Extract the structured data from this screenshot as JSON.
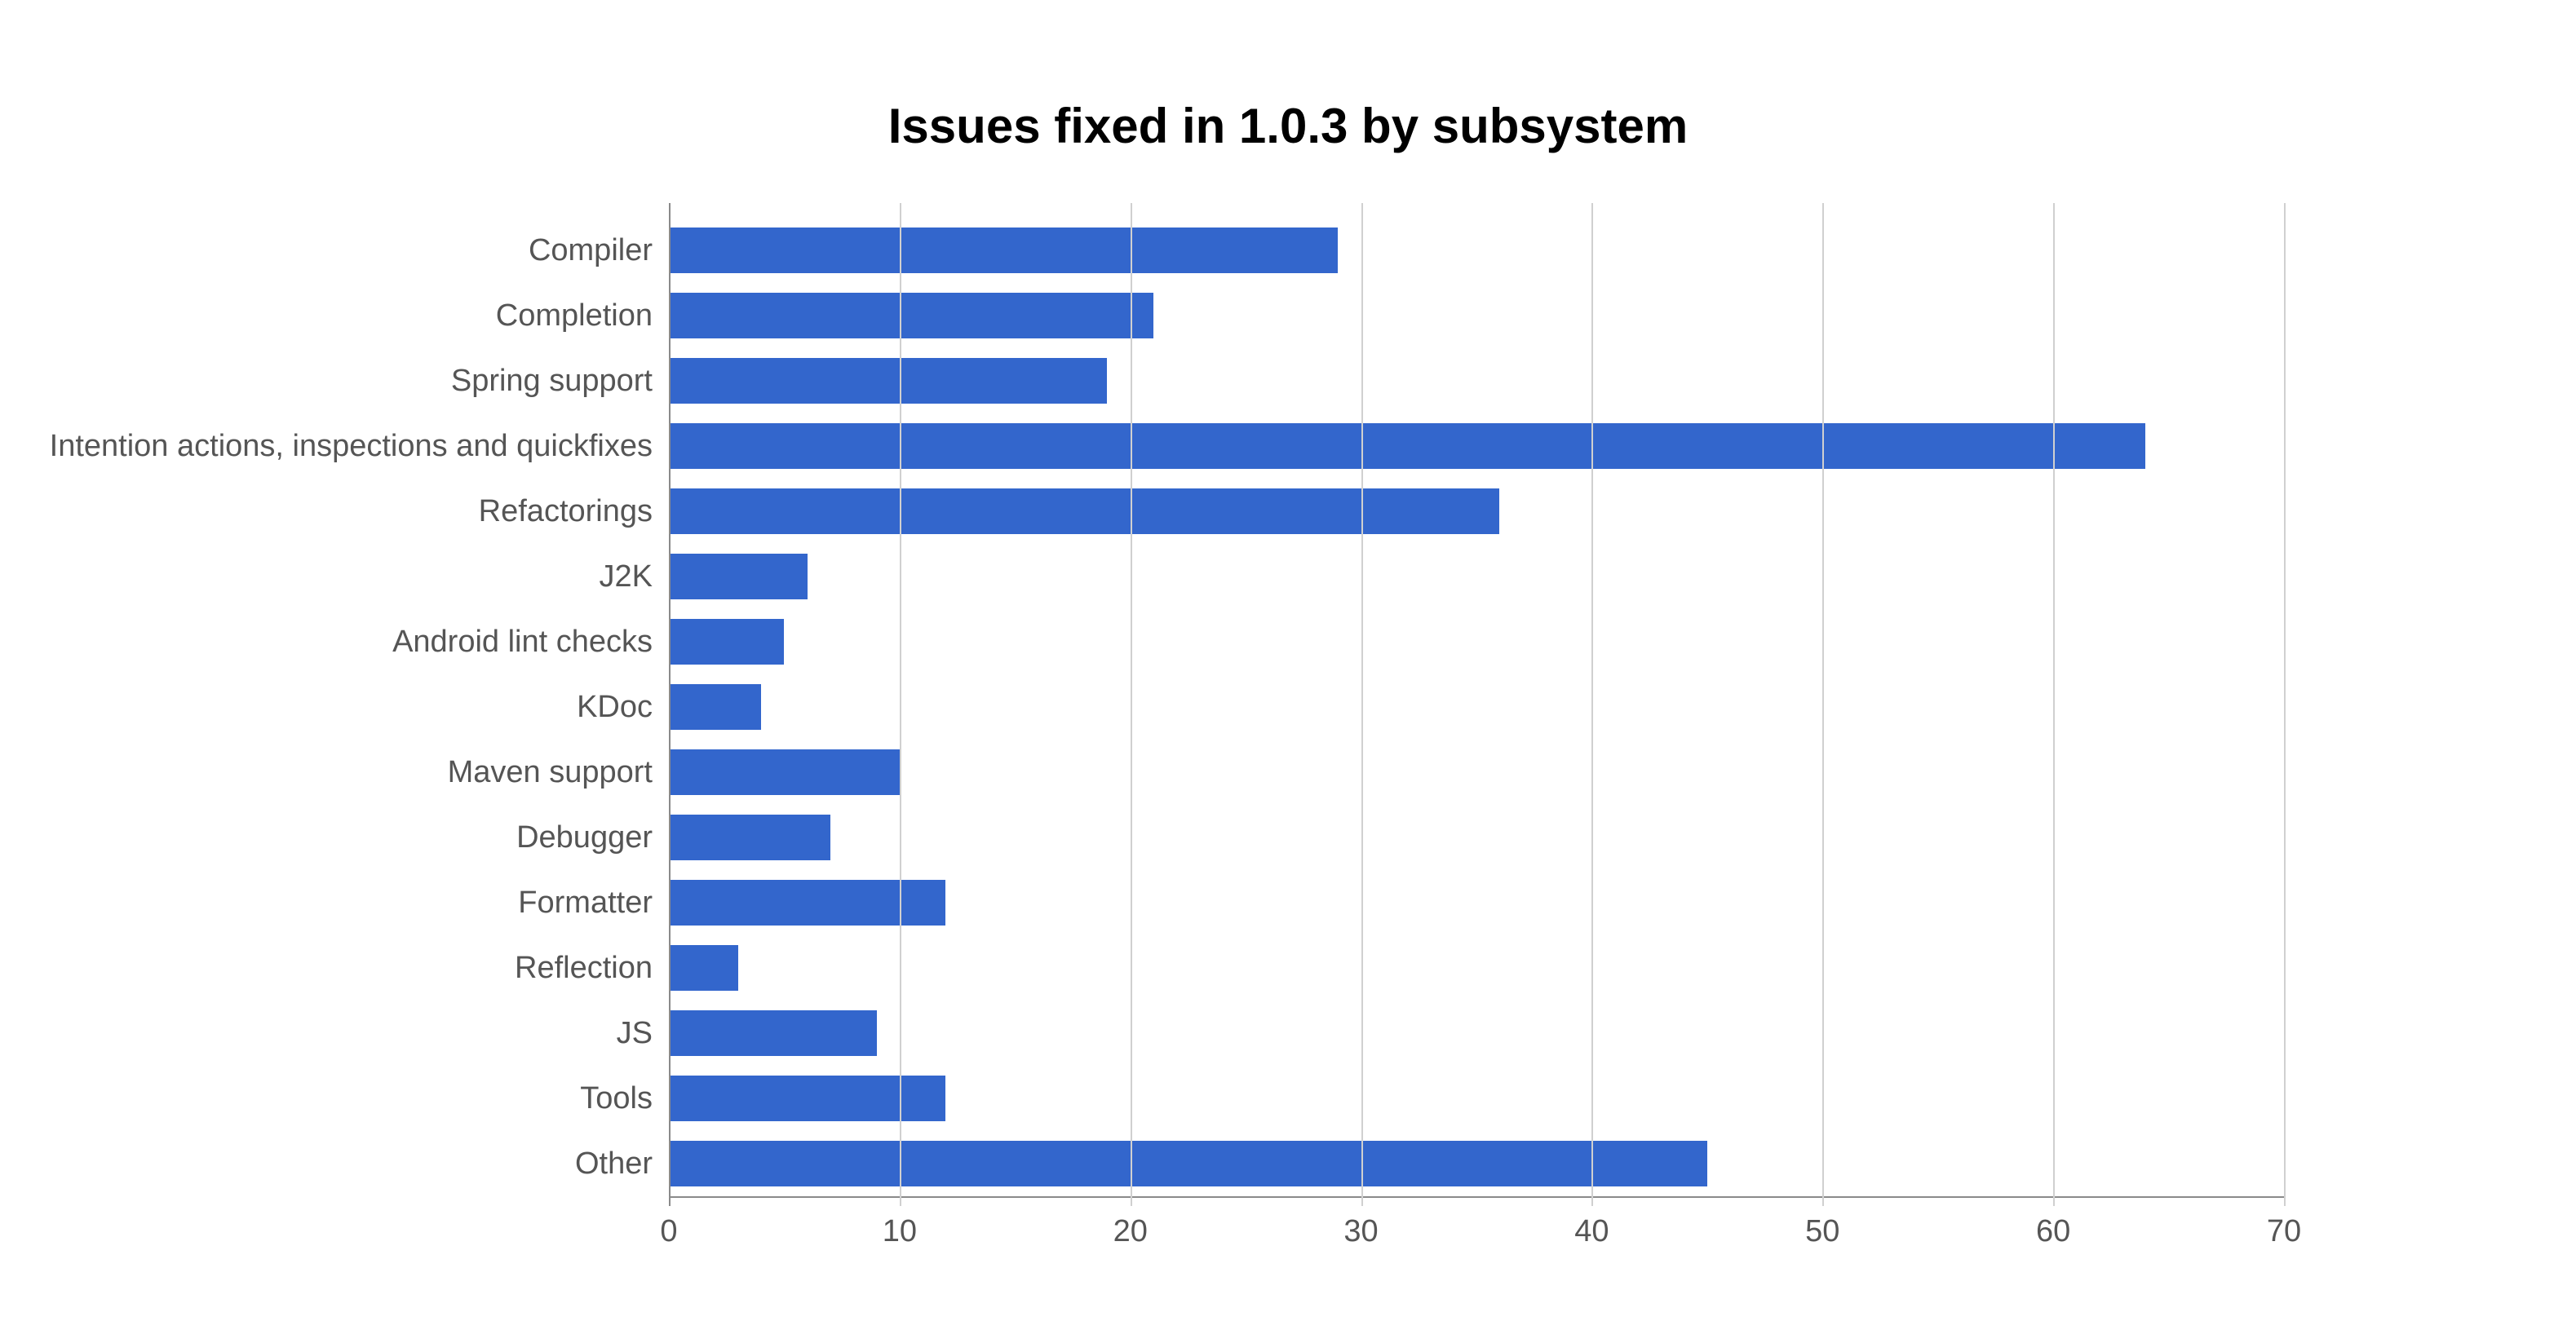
{
  "chart_data": {
    "type": "bar",
    "orientation": "horizontal",
    "title": "Issues fixed in 1.0.3 by subsystem",
    "categories": [
      "Compiler",
      "Completion",
      "Spring support",
      "Intention actions, inspections and quickfixes",
      "Refactorings",
      "J2K",
      "Android lint checks",
      "KDoc",
      "Maven support",
      "Debugger",
      "Formatter",
      "Reflection",
      "JS",
      "Tools",
      "Other"
    ],
    "values": [
      29,
      21,
      19,
      64,
      36,
      6,
      5,
      4,
      10,
      7,
      12,
      3,
      9,
      12,
      45
    ],
    "xlim": [
      0,
      70
    ],
    "xticks": [
      0,
      10,
      20,
      30,
      40,
      50,
      60,
      70
    ],
    "bar_color": "#3366cc",
    "grid_color": "#d0d0d0"
  }
}
